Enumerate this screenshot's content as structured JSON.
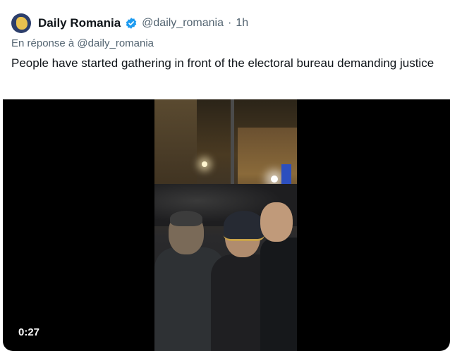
{
  "tweet": {
    "author_name": "Daily Romania",
    "author_handle": "@daily_romania",
    "separator": "·",
    "timestamp": "1h",
    "reply_prefix": "En réponse à",
    "reply_to": "@daily_romania",
    "text": "People have started gathering in front of the electoral bureau demanding justice",
    "verified_icon": "verified-badge-icon",
    "verified_color": "#1d9bf0"
  },
  "media": {
    "type": "video",
    "duration": "0:27"
  }
}
